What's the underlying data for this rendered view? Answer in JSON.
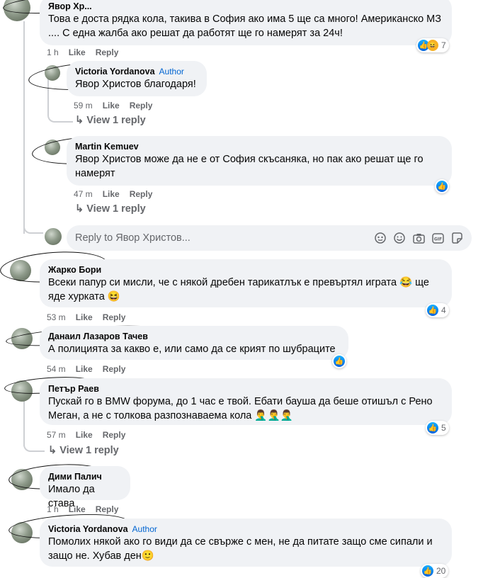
{
  "comments": [
    {
      "name": "Явор Хр... ",
      "text": "Това е доста рядка кола, такива в София ако има 5 ще са много! Американско МЗ .... С една жалба ако решат да работят ще го намерят за 24ч!",
      "time": "1 h",
      "like": "Like",
      "reply": "Reply",
      "reactions": "7"
    },
    {
      "name": "Victoria Yordanova",
      "badge": "Author",
      "tag": "Явор Христов",
      "text": " благодаря!",
      "time": "59 m",
      "like": "Like",
      "reply": "Reply",
      "view_reply": "View 1 reply"
    },
    {
      "name": "Martin Kemuev",
      "tag": "Явор Христов",
      "text": " може да не е от София скъсаняка, но пак ако решат ще го намерят",
      "time": "47 m",
      "like": "Like",
      "reply": "Reply",
      "view_reply": "View 1 reply"
    },
    {
      "name": "Жарко Бори",
      "text": "Всеки папур си мисли, че с някой дребен тарикатлък е превъртял играта 😂 ще яде хурката 😆",
      "time": "53 m",
      "like": "Like",
      "reply": "Reply",
      "reactions": "4"
    },
    {
      "name": "Данаил Лазаров Тачев",
      "text": "А полицията за какво е, или само да се крият по шубраците",
      "time": "54 m",
      "like": "Like",
      "reply": "Reply"
    },
    {
      "name": "Петър Раев",
      "text": "Пускай го в BMW форума, до 1 час е твой. Ебати бауша да беше отишъл с Рено Меган, а не с толкова разпознаваема кола 🤦‍♂️🤦‍♂️🤦‍♂️",
      "time": "57 m",
      "like": "Like",
      "reply": "Reply",
      "reactions": "5",
      "view_reply": "View 1 reply"
    },
    {
      "name": "Дими Палич",
      "text": "Имало да става",
      "time": "1 h",
      "like": "Like",
      "reply": "Reply"
    },
    {
      "name": "Victoria Yordanova",
      "badge": "Author",
      "text": "Помолих някой ако го види да се свърже с мен, не да питате защо сме сипали и защо не. Хубав ден🙂",
      "reactions": "20"
    }
  ],
  "reply_box": {
    "placeholder": "Reply to Явор Христов...",
    "icons": [
      "avatar-icon",
      "sticker-icon",
      "emoji-icon",
      "camera-icon",
      "gif-icon",
      "sticker-alt-icon"
    ]
  }
}
